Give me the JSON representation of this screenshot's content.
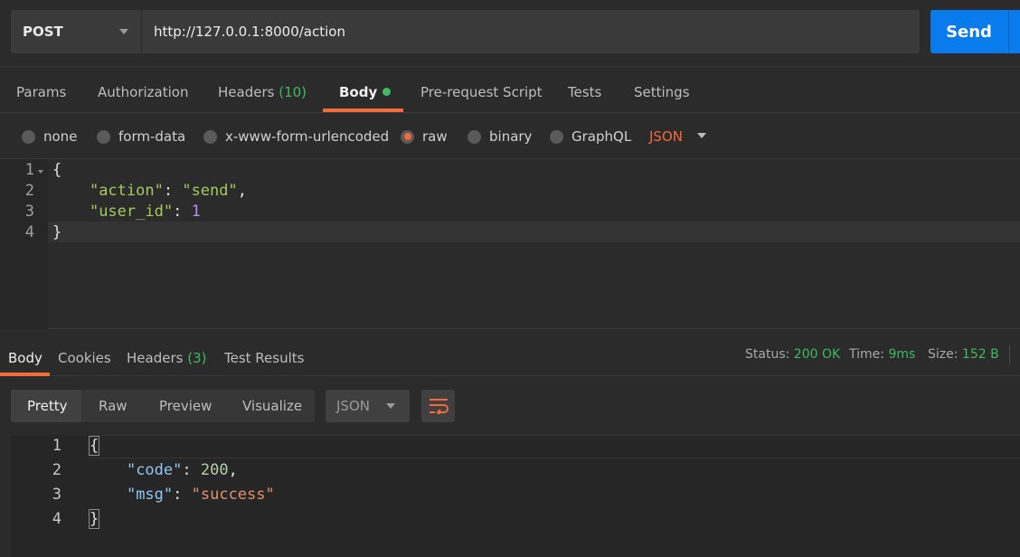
{
  "request": {
    "method": "POST",
    "url": "http://127.0.0.1:8000/action",
    "send_label": "Send"
  },
  "tabs": [
    {
      "label": "Params"
    },
    {
      "label": "Authorization"
    },
    {
      "label": "Headers",
      "count": "(10)"
    },
    {
      "label": "Body",
      "active": true
    },
    {
      "label": "Pre-request Script"
    },
    {
      "label": "Tests"
    },
    {
      "label": "Settings"
    }
  ],
  "body_types": [
    {
      "label": "none"
    },
    {
      "label": "form-data"
    },
    {
      "label": "x-www-form-urlencoded"
    },
    {
      "label": "raw",
      "selected": true
    },
    {
      "label": "binary"
    },
    {
      "label": "GraphQL"
    }
  ],
  "body_format": "JSON",
  "request_body": {
    "line_numbers": [
      "1",
      "2",
      "3",
      "4"
    ],
    "open": "{",
    "close": "}",
    "fields": [
      {
        "key": "\"action\"",
        "sep": ": ",
        "value": "\"send\"",
        "tail": ","
      },
      {
        "key": "\"user_id\"",
        "sep": ": ",
        "value": "1",
        "tail": ""
      }
    ]
  },
  "response": {
    "tabs": [
      {
        "label": "Body",
        "active": true
      },
      {
        "label": "Cookies"
      },
      {
        "label": "Headers",
        "count": "(3)"
      },
      {
        "label": "Test Results"
      }
    ],
    "status_label": "Status:",
    "status_value": "200 OK",
    "time_label": "Time:",
    "time_value": "9ms",
    "size_label": "Size:",
    "size_value": "152 B",
    "views": [
      {
        "label": "Pretty",
        "active": true
      },
      {
        "label": "Raw"
      },
      {
        "label": "Preview"
      },
      {
        "label": "Visualize"
      }
    ],
    "format": "JSON",
    "line_numbers": [
      "1",
      "2",
      "3",
      "4"
    ],
    "open": "{",
    "close": "}",
    "fields": [
      {
        "key": "\"code\"",
        "sep": ": ",
        "value": "200",
        "tail": ","
      },
      {
        "key": "\"msg\"",
        "sep": ": ",
        "value": "\"success\"",
        "tail": ""
      }
    ]
  },
  "colors": {
    "accent": "#f26b3a",
    "send_blue": "#097bed",
    "success_green": "#3dbb5e"
  }
}
